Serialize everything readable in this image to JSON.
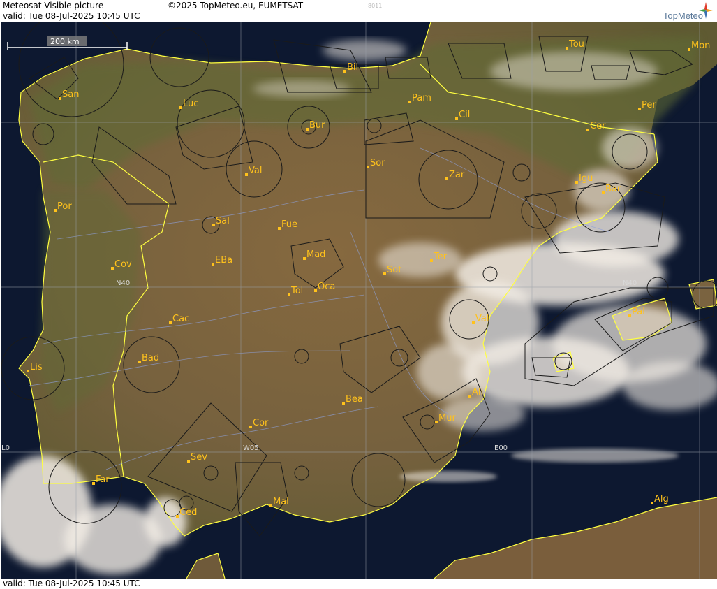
{
  "header": {
    "title": "Meteosat Visible picture",
    "copyright": "©2025 TopMeteo.eu, EUMETSAT",
    "code": "8011",
    "valid": "valid:  Tue  08-Jul-2025  10:45 UTC",
    "logo_text": "TopMeteo"
  },
  "footer": {
    "valid": "valid:  Tue  08-Jul-2025  10:45 UTC"
  },
  "scale": {
    "label": "200 km"
  },
  "grid_labels": {
    "lat": "N40",
    "lat_east": "N40",
    "lon_west": "W05",
    "lon_zero": "E00",
    "lon_far": "L0"
  },
  "cities": [
    {
      "label": "San"
    },
    {
      "label": "Luc"
    },
    {
      "label": "Bil"
    },
    {
      "label": "Pam"
    },
    {
      "label": "Tou"
    },
    {
      "label": "Mon"
    },
    {
      "label": "Per"
    },
    {
      "label": "Cil"
    },
    {
      "label": "Cer"
    },
    {
      "label": "Bur"
    },
    {
      "label": "Val"
    },
    {
      "label": "Sor"
    },
    {
      "label": "Zar"
    },
    {
      "label": "Igu"
    },
    {
      "label": "Bar"
    },
    {
      "label": "Por"
    },
    {
      "label": "Sal"
    },
    {
      "label": "Fue"
    },
    {
      "label": "Mad"
    },
    {
      "label": "Cov"
    },
    {
      "label": "EBa"
    },
    {
      "label": "Ter"
    },
    {
      "label": "Sot"
    },
    {
      "label": "Tol"
    },
    {
      "label": "Oca"
    },
    {
      "label": "Pal"
    },
    {
      "label": "Val"
    },
    {
      "label": "Cac"
    },
    {
      "label": "Bad"
    },
    {
      "label": "Lis"
    },
    {
      "label": "Ali"
    },
    {
      "label": "Bea"
    },
    {
      "label": "Mur"
    },
    {
      "label": "Cor"
    },
    {
      "label": "Sev"
    },
    {
      "label": "Far"
    },
    {
      "label": "Mal"
    },
    {
      "label": "Ced"
    },
    {
      "label": "Alg"
    }
  ],
  "colors": {
    "sea": "#0d1830",
    "land": "#7b6440",
    "cloud": "#f2ece4",
    "border": "#ffff40",
    "label": "#ffc21c",
    "grid": "#9aa0a8"
  }
}
